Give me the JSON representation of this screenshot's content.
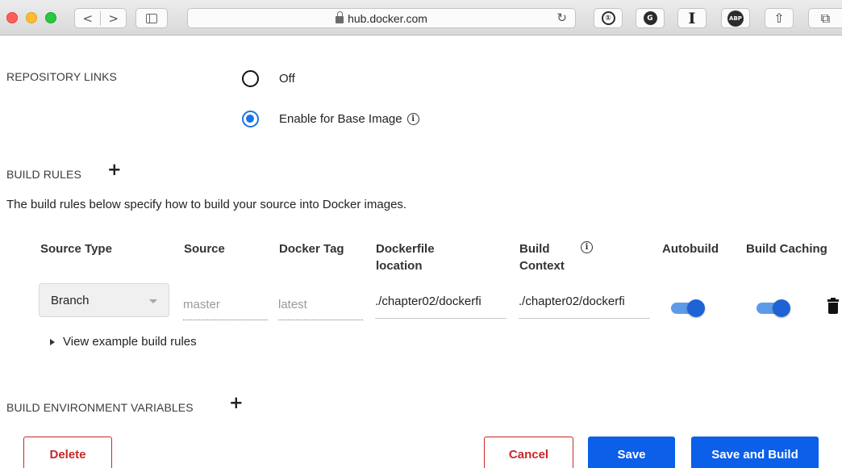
{
  "browser": {
    "url": "hub.docker.com",
    "back_glyph": "<",
    "forward_glyph": ">",
    "reload_glyph": "↻",
    "share_glyph": "⇧",
    "tabs_glyph": "⧉",
    "extensions": [
      {
        "icon": "onepassword-icon",
        "text": "①"
      },
      {
        "icon": "grammarly-icon",
        "text": "G"
      },
      {
        "icon": "instapaper-icon",
        "text": "I"
      },
      {
        "icon": "adblock-plus-icon",
        "text": "ABP"
      }
    ]
  },
  "repository_links": {
    "label": "REPOSITORY LINKS",
    "options": [
      {
        "label": "Off",
        "checked": false
      },
      {
        "label": "Enable for Base Image",
        "checked": true
      }
    ]
  },
  "build_rules": {
    "label": "BUILD RULES",
    "add_glyph": "+",
    "description": "The build rules below specify how to build your source into Docker images.",
    "columns": {
      "source_type": "Source Type",
      "source": "Source",
      "docker_tag": "Docker Tag",
      "dockerfile_location": "Dockerfile location",
      "build_context": "Build Context",
      "autobuild": "Autobuild",
      "build_caching": "Build Caching"
    },
    "info_glyph": "i",
    "rule": {
      "source_type": "Branch",
      "source_placeholder": "master",
      "docker_tag_placeholder": "latest",
      "dockerfile_location": "./chapter02/dockerfi",
      "build_context": "./chapter02/dockerfi",
      "autobuild": true,
      "build_caching": true
    },
    "examples_link": "View example build rules"
  },
  "env_vars": {
    "label": "BUILD ENVIRONMENT VARIABLES",
    "add_glyph": "+"
  },
  "actions": {
    "delete": "Delete",
    "cancel": "Cancel",
    "save": "Save",
    "save_and_build": "Save and Build"
  },
  "colors": {
    "primary": "#0b5fe8",
    "danger": "#c62828",
    "radio_checked": "#1a73e8",
    "toggle_on": "#1d63d6"
  }
}
